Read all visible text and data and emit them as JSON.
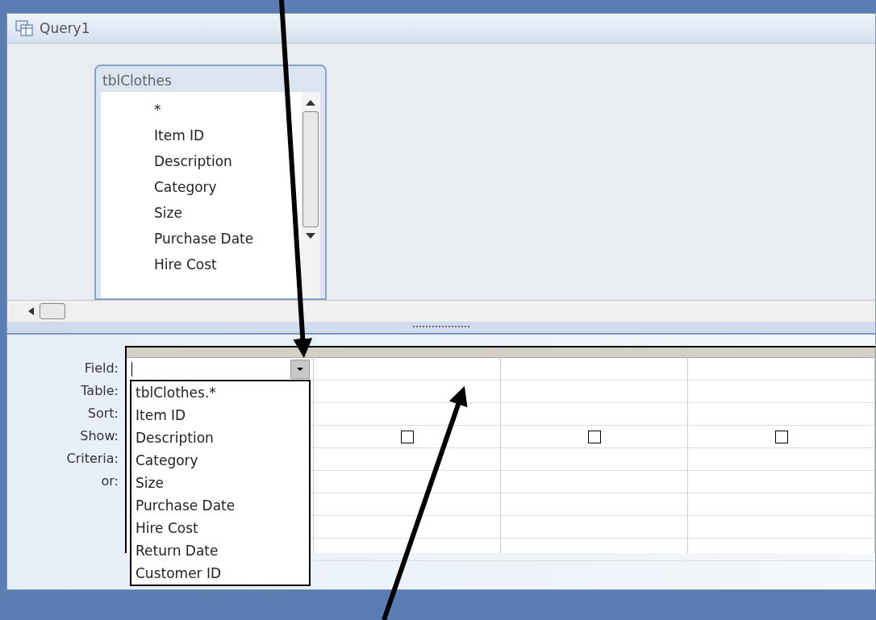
{
  "window": {
    "title": "Query1"
  },
  "table_box": {
    "title": "tblClothes",
    "fields": [
      "*",
      "Item ID",
      "Description",
      "Category",
      "Size",
      "Purchase Date",
      "Hire Cost"
    ]
  },
  "grid": {
    "row_labels": [
      "Field:",
      "Table:",
      "Sort:",
      "Show:",
      "Criteria:",
      "or:"
    ],
    "show_checkboxes": [
      {
        "checked": false
      },
      {
        "checked": false
      },
      {
        "checked": false
      }
    ],
    "dropdown": {
      "expanded": true,
      "items": [
        "tblClothes.*",
        "Item ID",
        "Description",
        "Category",
        "Size",
        "Purchase Date",
        "Hire Cost",
        "Return Date",
        "Customer ID"
      ]
    }
  }
}
